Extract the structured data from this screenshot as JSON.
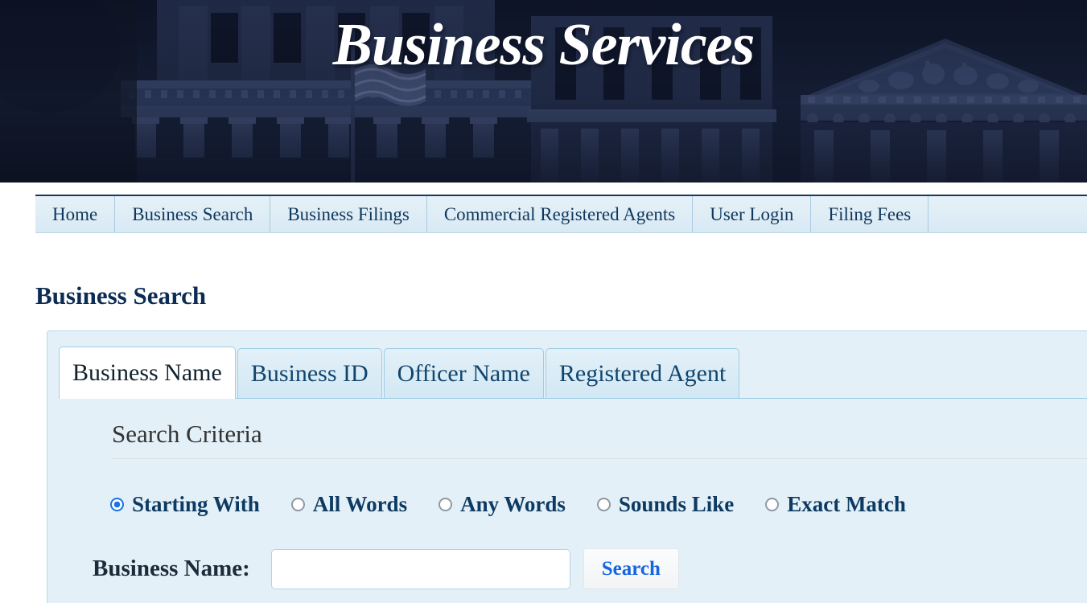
{
  "banner": {
    "title": "Business Services",
    "image_description": "state capitol building photo",
    "tint_color": "#1f2b48"
  },
  "nav": {
    "items": [
      {
        "label": "Home"
      },
      {
        "label": "Business Search"
      },
      {
        "label": "Business Filings"
      },
      {
        "label": "Commercial Registered Agents"
      },
      {
        "label": "User Login"
      },
      {
        "label": "Filing Fees"
      }
    ]
  },
  "page": {
    "title": "Business Search"
  },
  "tabs": [
    {
      "label": "Business Name",
      "active": true
    },
    {
      "label": "Business ID",
      "active": false
    },
    {
      "label": "Officer Name",
      "active": false
    },
    {
      "label": "Registered Agent",
      "active": false
    }
  ],
  "search_panel": {
    "section_heading": "Search Criteria",
    "match_options": [
      {
        "label": "Starting With",
        "selected": true
      },
      {
        "label": "All Words",
        "selected": false
      },
      {
        "label": "Any Words",
        "selected": false
      },
      {
        "label": "Sounds Like",
        "selected": false
      },
      {
        "label": "Exact Match",
        "selected": false
      }
    ],
    "field": {
      "label": "Business Name:",
      "value": "",
      "placeholder": ""
    },
    "search_button": "Search"
  },
  "colors": {
    "banner_navy": "#1f2b48",
    "nav_bg": "#dcebf5",
    "panel_bg": "#e4f0f8",
    "title_navy": "#0d2c54",
    "accent_blue": "#1565e0",
    "radio_blue": "#1a73e8"
  }
}
